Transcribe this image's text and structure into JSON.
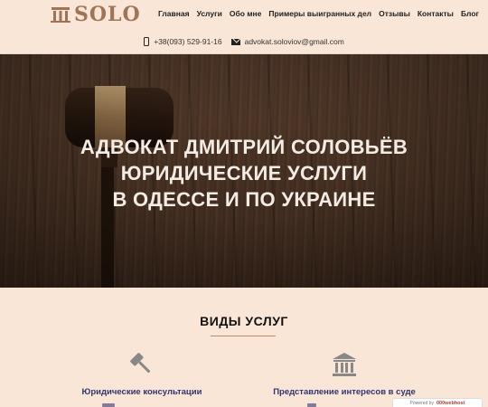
{
  "brand": {
    "logo_text": "SOLO"
  },
  "nav": {
    "items": [
      {
        "label": "Главная"
      },
      {
        "label": "Услуги"
      },
      {
        "label": "Обо мне"
      },
      {
        "label": "Примеры выигранных дел"
      },
      {
        "label": "Отзывы"
      },
      {
        "label": "Контакты"
      },
      {
        "label": "Блог"
      }
    ]
  },
  "contacts": {
    "phone": "+38(093) 529-91-16",
    "email": "advokat.soloviov@gmail.com"
  },
  "hero": {
    "lines": [
      "АДВОКАТ ДМИТРИЙ СОЛОВЬЁВ",
      "ЮРИДИЧЕСКИЕ УСЛУГИ",
      "В ОДЕССЕ И ПО УКРАИНЕ"
    ]
  },
  "services": {
    "title": "ВИДЫ УСЛУГ",
    "items": [
      {
        "label": "Юридические консультации",
        "icon": "gavel-icon"
      },
      {
        "label": "Представление интересов в суде",
        "icon": "courthouse-icon"
      }
    ]
  },
  "widget": {
    "powered_by": "Powered by",
    "brand": "000webhost"
  },
  "colors": {
    "background": "#fae6d6",
    "accent": "#a07555",
    "link": "#2f3570",
    "divider": "#b78a6a"
  }
}
